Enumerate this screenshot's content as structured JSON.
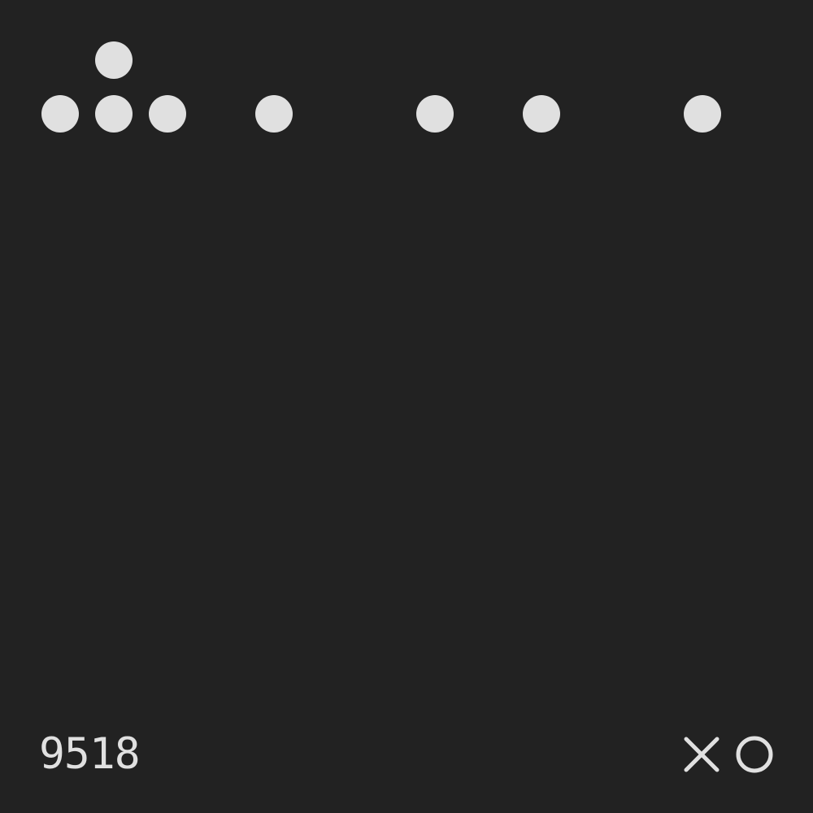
{
  "colors": {
    "background": "#222222",
    "foreground": "#e0e0e0"
  },
  "token_id": "9518",
  "logo": {
    "icons": [
      "x-icon",
      "o-icon"
    ]
  },
  "board": {
    "columns": 14,
    "column_heights": [
      1,
      2,
      1,
      0,
      1,
      0,
      0,
      1,
      0,
      1,
      0,
      0,
      1,
      0
    ]
  }
}
